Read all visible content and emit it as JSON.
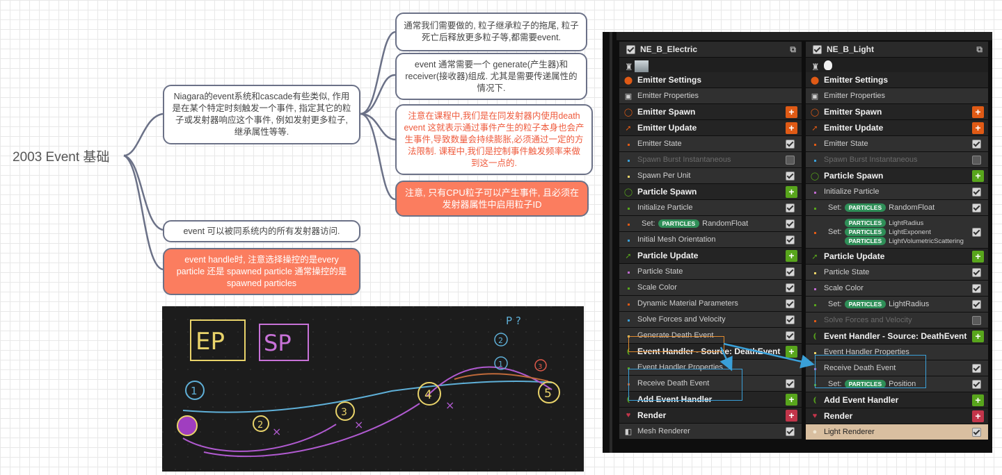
{
  "mindmap": {
    "root": "2003 Event 基础",
    "n1": "Niagara的event系统和cascade有些类似, 作用是在某个特定时刻触发一个事件, 指定其它的粒子或发射器响应这个事件, 例如发射更多粒子,继承属性等等.",
    "n2": "通常我们需要做的, 粒子继承粒子的拖尾, 粒子死亡后释放更多粒子等,都需要event.",
    "n3": "event 通常需要一个 generate(产生器)和receiver(接收器)组成. 尤其是需要传递属性的情况下.",
    "n4": "注意在课程中,我们是在同发射器内使用death event 这就表示通过事件产生的粒子本身也会产生事件,导致数量会持续膨胀,必须通过一定的方法限制. 课程中,我们是控制事件触发频率来做到这一点的.",
    "n5": "注意, 只有CPU粒子可以产生事件, 且必须在发射器属性中启用粒子ID",
    "n6": "event 可以被同系统内的所有发射器访问.",
    "n7": "event handle时, 注意选择操控的是every particle 还是 spawned particle 通常操控的是spawned particles"
  },
  "sketch": {
    "ep": "EP",
    "sp": "SP",
    "labels": [
      "1",
      "2",
      "3",
      "4",
      "5",
      "2",
      "1",
      "3",
      "P ?"
    ]
  },
  "left_emitter": {
    "name": "NE_B_Electric",
    "rows": [
      {
        "type": "stage",
        "icon": "emitter-settings-icon",
        "label": "Emitter Settings"
      },
      {
        "type": "mod",
        "icon": "cpu-icon",
        "label": "Emitter Properties"
      },
      {
        "type": "stage",
        "icon": "spawn-icon",
        "label": "Emitter Spawn",
        "plus": "o"
      },
      {
        "type": "stage",
        "icon": "update-icon",
        "label": "Emitter Update",
        "plus": "o"
      },
      {
        "type": "mod",
        "label": "Emitter State",
        "check": true
      },
      {
        "type": "mod dim",
        "label": "Spawn Burst Instantaneous",
        "check": false
      },
      {
        "type": "mod",
        "label": "Spawn Per Unit",
        "check": true
      },
      {
        "type": "stage",
        "icon": "particle-spawn-icon",
        "label": "Particle Spawn",
        "plus": "g"
      },
      {
        "type": "mod",
        "label": "Initialize Particle",
        "check": true
      },
      {
        "type": "mod",
        "label": "Set:",
        "pill": "PARTICLES",
        "after": "RandomFloat",
        "check": true
      },
      {
        "type": "mod",
        "label": "Initial Mesh Orientation",
        "check": true
      },
      {
        "type": "stage",
        "icon": "particle-update-icon",
        "label": "Particle Update",
        "plus": "g"
      },
      {
        "type": "mod",
        "label": "Particle State",
        "check": true
      },
      {
        "type": "mod",
        "label": "Scale Color",
        "check": true
      },
      {
        "type": "mod",
        "label": "Dynamic Material Parameters",
        "check": true
      },
      {
        "type": "mod",
        "label": "Solve Forces and Velocity",
        "check": true
      },
      {
        "type": "mod",
        "label": "Generate Death Event",
        "check": true
      },
      {
        "type": "stage",
        "icon": "event-handler-icon",
        "label": "Event Handler - Source: DeathEvent",
        "plus": "g"
      },
      {
        "type": "mod",
        "label": "Event Handler Properties"
      },
      {
        "type": "mod",
        "label": "Receive Death Event",
        "check": true
      },
      {
        "type": "stage",
        "icon": "event-handler-icon",
        "label": "Add Event Handler",
        "plus": "g"
      },
      {
        "type": "stage",
        "icon": "render-icon",
        "label": "Render",
        "plus": "r"
      },
      {
        "type": "mod",
        "icon": "mesh-icon",
        "label": "Mesh Renderer",
        "check": true
      }
    ]
  },
  "right_emitter": {
    "name": "NE_B_Light",
    "rows": [
      {
        "type": "stage",
        "icon": "emitter-settings-icon",
        "label": "Emitter Settings"
      },
      {
        "type": "mod",
        "icon": "cpu-icon",
        "label": "Emitter Properties"
      },
      {
        "type": "stage",
        "icon": "spawn-icon",
        "label": "Emitter Spawn",
        "plus": "o"
      },
      {
        "type": "stage",
        "icon": "update-icon",
        "label": "Emitter Update",
        "plus": "o"
      },
      {
        "type": "mod",
        "label": "Emitter State",
        "check": true
      },
      {
        "type": "mod dim",
        "label": "Spawn Burst Instantaneous",
        "check": false
      },
      {
        "type": "stage",
        "icon": "particle-spawn-icon",
        "label": "Particle Spawn",
        "plus": "g"
      },
      {
        "type": "mod",
        "label": "Initialize Particle",
        "check": true
      },
      {
        "type": "mod",
        "label": "Set:",
        "pill": "PARTICLES",
        "after": "RandomFloat",
        "check": true
      },
      {
        "type": "mod tall",
        "label": "Set:",
        "multi": [
          "LightRadius",
          "LightExponent",
          "LightVolumetricScattering"
        ],
        "check": true
      },
      {
        "type": "stage",
        "icon": "particle-update-icon",
        "label": "Particle Update",
        "plus": "g"
      },
      {
        "type": "mod",
        "label": "Particle State",
        "check": true
      },
      {
        "type": "mod",
        "label": "Scale Color",
        "check": true
      },
      {
        "type": "mod",
        "label": "Set:",
        "pill": "PARTICLES",
        "after": "LightRadius",
        "check": true
      },
      {
        "type": "mod dim",
        "label": "Solve Forces and Velocity",
        "check": false
      },
      {
        "type": "stage",
        "icon": "event-handler-icon",
        "label": "Event Handler - Source: DeathEvent",
        "plus": "g"
      },
      {
        "type": "mod",
        "label": "Event Handler Properties"
      },
      {
        "type": "mod",
        "label": "Receive Death Event",
        "check": true
      },
      {
        "type": "mod",
        "label": "Set:",
        "pill": "PARTICLES",
        "after": "Position",
        "check": true
      },
      {
        "type": "stage",
        "icon": "event-handler-icon",
        "label": "Add Event Handler",
        "plus": "g"
      },
      {
        "type": "stage",
        "icon": "render-icon",
        "label": "Render",
        "plus": "r"
      },
      {
        "type": "mod",
        "icon": "light-icon",
        "label": "Light Renderer",
        "check": true
      }
    ]
  },
  "colors": {
    "accent_orange": "#fb7d5f",
    "node_border": "#6b7187",
    "link_blue": "#3aa0d8",
    "plus_green": "#58a51c",
    "plus_orange": "#e05a15",
    "plus_red": "#c2354a"
  }
}
